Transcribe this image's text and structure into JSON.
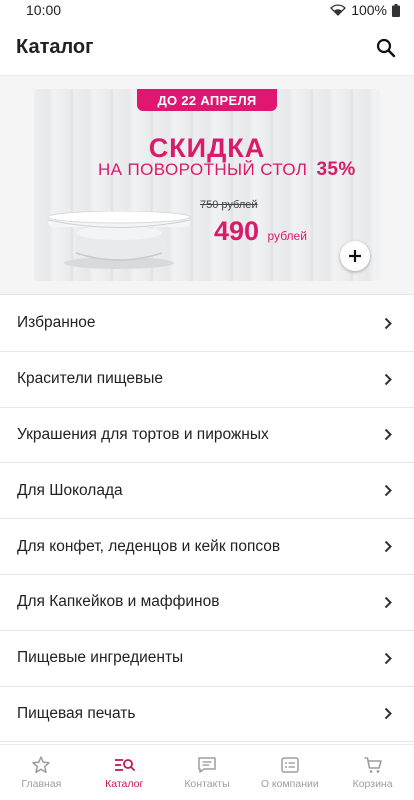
{
  "status_bar": {
    "time": "10:00",
    "battery": "100%"
  },
  "app_bar": {
    "title": "Каталог"
  },
  "banner": {
    "ribbon": "ДО 22 АПРЕЛЯ",
    "headline": "СКИДКА",
    "subline": "НА ПОВОРОТНЫЙ СТОЛ",
    "discount": "35%",
    "old_price": "750 рублей",
    "new_price": "490",
    "currency": "рублей",
    "accent_color": "#d81b6a"
  },
  "categories": [
    {
      "label": "Избранное"
    },
    {
      "label": "Красители пищевые"
    },
    {
      "label": "Украшения для тортов и пирожных"
    },
    {
      "label": "Для Шоколада"
    },
    {
      "label": "Для конфет, леденцов и кейк попсов"
    },
    {
      "label": "Для Капкейков и маффинов"
    },
    {
      "label": "Пищевые ингредиенты"
    },
    {
      "label": "Пищевая печать"
    }
  ],
  "bottom_nav": {
    "active_color": "#c2185b",
    "items": [
      {
        "label": "Главная",
        "icon": "star-icon"
      },
      {
        "label": "Каталог",
        "icon": "catalog-search-icon",
        "active": true
      },
      {
        "label": "Контакты",
        "icon": "chat-icon"
      },
      {
        "label": "О компании",
        "icon": "info-list-icon"
      },
      {
        "label": "Корзина",
        "icon": "cart-icon"
      }
    ]
  }
}
